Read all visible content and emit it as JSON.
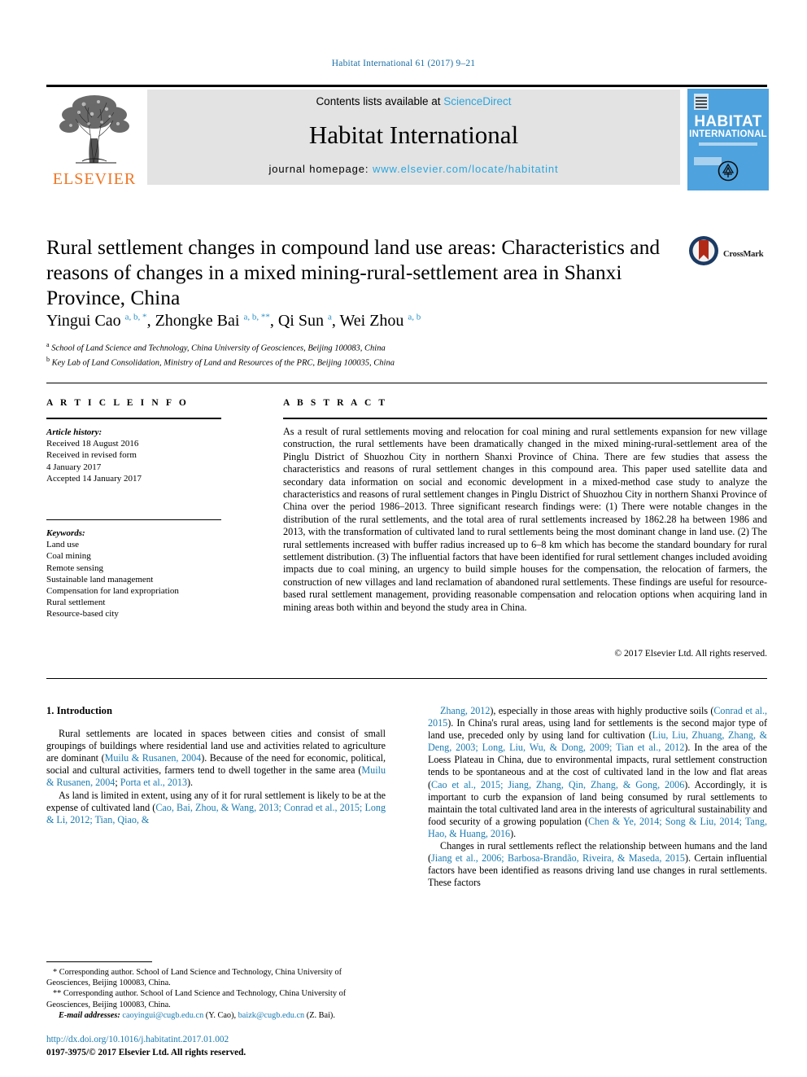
{
  "running_head": "Habitat International 61 (2017) 9–21",
  "masthead": {
    "contents_line": "Contents lists available at ",
    "sciencedirect": "ScienceDirect",
    "journal_title": "Habitat International",
    "homepage_label": "journal homepage: ",
    "homepage_url": "www.elsevier.com/locate/habitatint",
    "publisher": "ELSEVIER",
    "cover": {
      "line1": "HABITAT",
      "line2": "INTERNATIONAL"
    }
  },
  "article": {
    "title": "Rural settlement changes in compound land use areas: Characteristics and reasons of changes in a mixed mining-rural-settlement area in Shanxi Province, China",
    "crossmark_label": "CrossMark",
    "authors_html": "Yingui Cao <sup class=\"aff-mark\">a, b, *</sup>, Zhongke Bai <sup class=\"aff-mark\">a, b, **</sup>, Qi Sun <sup class=\"aff-mark\">a</sup>, Wei Zhou <sup class=\"aff-mark\">a, b</sup>",
    "affiliation_a": "School of Land Science and Technology, China University of Geosciences, Beijing 100083, China",
    "affiliation_b": "Key Lab of Land Consolidation, Ministry of Land and Resources of the PRC, Beijing 100035, China"
  },
  "sections": {
    "article_info_label": "A R T I C L E   I N F O",
    "abstract_label": "A B S T R A C T"
  },
  "article_history": {
    "heading": "Article history:",
    "lines": [
      "Received 18 August 2016",
      "Received in revised form",
      "4 January 2017",
      "Accepted 14 January 2017"
    ]
  },
  "keywords": {
    "heading": "Keywords:",
    "items": [
      "Land use",
      "Coal mining",
      "Remote sensing",
      "Sustainable land management",
      "Compensation for land expropriation",
      "Rural settlement",
      "Resource-based city"
    ]
  },
  "abstract": {
    "text": "As a result of rural settlements moving and relocation for coal mining and rural settlements expansion for new village construction, the rural settlements have been dramatically changed in the mixed mining-rural-settlement area of the Pinglu District of Shuozhou City in northern Shanxi Province of China. There are few studies that assess the characteristics and reasons of rural settlement changes in this compound area. This paper used satellite data and secondary data information on social and economic development in a mixed-method case study to analyze the characteristics and reasons of rural settlement changes in Pinglu District of Shuozhou City in northern Shanxi Province of China over the period 1986–2013. Three significant research findings were: (1) There were notable changes in the distribution of the rural settlements, and the total area of rural settlements increased by 1862.28 ha between 1986 and 2013, with the transformation of cultivated land to rural settlements being the most dominant change in land use. (2) The rural settlements increased with buffer radius increased up to 6–8 km which has become the standard boundary for rural settlement distribution. (3) The influential factors that have been identified for rural settlement changes included avoiding impacts due to coal mining, an urgency to build simple houses for the compensation, the relocation of farmers, the construction of new villages and land reclamation of abandoned rural settlements. These findings are useful for resource-based rural settlement management, providing reasonable compensation and relocation options when acquiring land in mining areas both within and beyond the study area in China.",
    "copyright": "© 2017 Elsevier Ltd. All rights reserved."
  },
  "introduction": {
    "heading": "1. Introduction",
    "left_paragraph_1_html": "Rural settlements are located in spaces between cities and consist of small groupings of buildings where residential land use and activities related to agriculture are dominant (<span class=\"cite\">Muilu &amp; Rusanen, 2004</span>). Because of the need for economic, political, social and cultural activities, farmers tend to dwell together in the same area (<span class=\"cite\">Muilu &amp; Rusanen, 2004</span>; <span class=\"cite\">Porta et al., 2013</span>).",
    "left_paragraph_2_html": "As land is limited in extent, using any of it for rural settlement is likely to be at the expense of cultivated land (<span class=\"cite\">Cao, Bai, Zhou, &amp; Wang, 2013; Conrad et al., 2015; Long &amp; Li, 2012; Tian, Qiao, &amp;</span>",
    "right_paragraph_1_html": "<span class=\"cite\">Zhang, 2012</span>), especially in those areas with highly productive soils (<span class=\"cite\">Conrad et al., 2015</span>). In China's rural areas, using land for settlements is the second major type of land use, preceded only by using land for cultivation (<span class=\"cite\">Liu, Liu, Zhuang, Zhang, &amp; Deng, 2003; Long, Liu, Wu, &amp; Dong, 2009; Tian et al., 2012</span>). In the area of the Loess Plateau in China, due to environmental impacts, rural settlement construction tends to be spontaneous and at the cost of cultivated land in the low and flat areas (<span class=\"cite\">Cao et al., 2015; Jiang, Zhang, Qin, Zhang, &amp; Gong, 2006</span>). Accordingly, it is important to curb the expansion of land being consumed by rural settlements to maintain the total cultivated land area in the interests of agricultural sustainability and food security of a growing population (<span class=\"cite\">Chen &amp; Ye, 2014; Song &amp; Liu, 2014; Tang, Hao, &amp; Huang, 2016</span>).",
    "right_paragraph_2_html": "Changes in rural settlements reflect the relationship between humans and the land (<span class=\"cite\">Jiang et al., 2006; Barbosa-Brandão, Riveira, &amp; Maseda, 2015</span>). Certain influential factors have been identified as reasons driving land use changes in rural settlements. These factors"
  },
  "footnotes": {
    "corresponding_1": "* Corresponding author. School of Land Science and Technology, China University of Geosciences, Beijing 100083, China.",
    "corresponding_2": "** Corresponding author. School of Land Science and Technology, China University of Geosciences, Beijing 100083, China.",
    "email_label": "E-mail addresses:",
    "email_1": "caoyingui@cugb.edu.cn",
    "email_1_owner": " (Y. Cao), ",
    "email_2": "baizk@cugb.edu.cn",
    "email_2_owner": " (Z. Bai).",
    "doi": "http://dx.doi.org/10.1016/j.habitatint.2017.01.002",
    "issn": "0197-3975/© 2017 Elsevier Ltd. All rights reserved."
  }
}
